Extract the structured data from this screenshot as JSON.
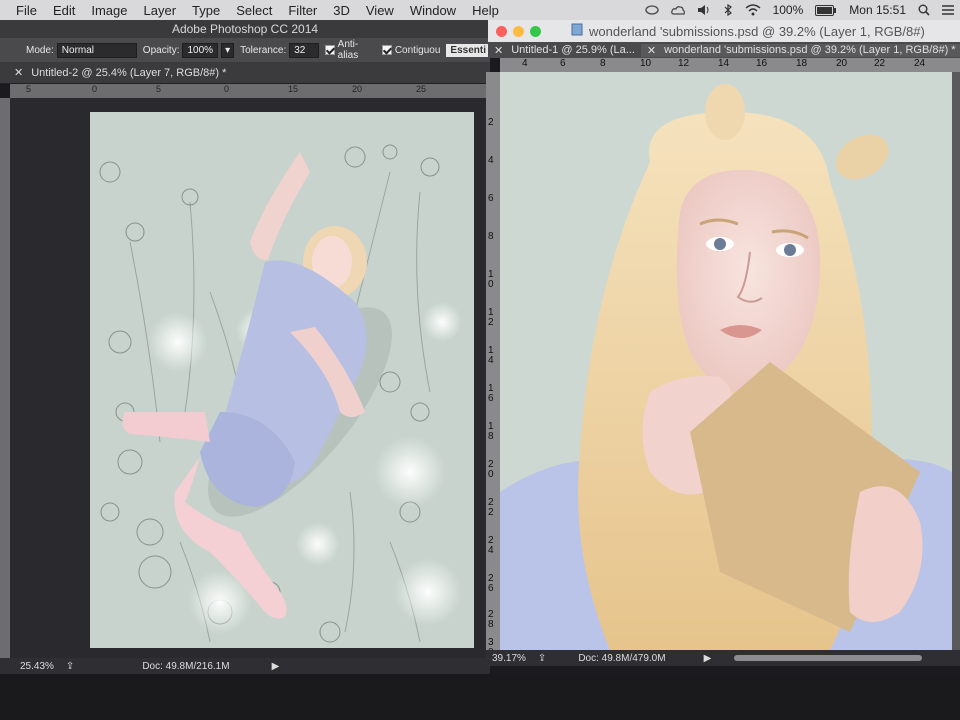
{
  "menubar": {
    "items": [
      "File",
      "Edit",
      "Image",
      "Layer",
      "Type",
      "Select",
      "Filter",
      "3D",
      "View",
      "Window",
      "Help"
    ],
    "battery": "100%",
    "clock": "Mon 15:51"
  },
  "left_window": {
    "app_title": "Adobe Photoshop CC 2014",
    "options": {
      "mode_label": "Mode:",
      "mode_value": "Normal",
      "opacity_label": "Opacity:",
      "opacity_value": "100%",
      "tolerance_label": "Tolerance:",
      "tolerance_value": "32",
      "antialias_label": "Anti-alias",
      "contiguous_label": "Contiguou",
      "workspace_label": "Essenti"
    },
    "doc_tab": "Untitled-2 @ 25.4% (Layer 7, RGB/8#) *",
    "ruler_ticks": [
      "5",
      "0",
      "5",
      "0",
      "15",
      "20",
      "25"
    ],
    "zoom": "25.43%",
    "doc_size": "Doc: 49.8M/216.1M"
  },
  "right_window": {
    "title": "wonderland 'submissions.psd @ 39.2% (Layer 1, RGB/8#)",
    "tabs": [
      "Untitled-1 @ 25.9% (La...",
      "wonderland 'submissions.psd @ 39.2% (Layer 1, RGB/8#) *"
    ],
    "ruler_ticks": [
      "4",
      "6",
      "8",
      "10",
      "12",
      "14",
      "16",
      "18",
      "20",
      "22",
      "24"
    ],
    "vruler_ticks": [
      "2",
      "4",
      "6",
      "8",
      "1 0",
      "1 2",
      "1 4",
      "1 6",
      "1 8",
      "2 0",
      "2 2",
      "2 4",
      "2 6",
      "2 8",
      "3 0"
    ],
    "zoom": "39.17%",
    "doc_size": "Doc: 49.8M/479.0M"
  },
  "colors": {
    "traffic_close": "#fc605c",
    "traffic_min": "#fdbc40",
    "traffic_max": "#34c84a"
  }
}
